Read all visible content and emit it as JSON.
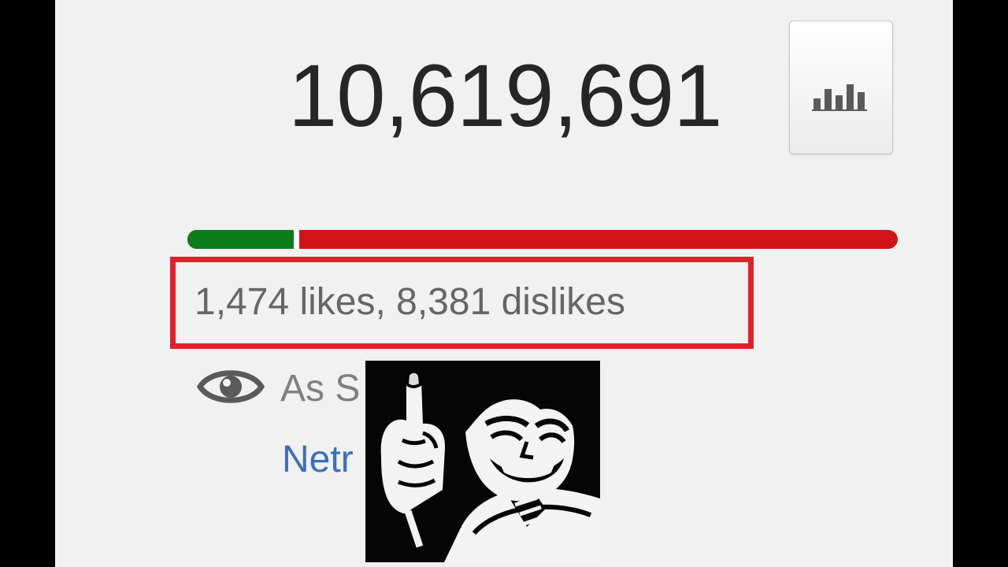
{
  "video": {
    "view_count": "10,619,691",
    "likes_dislikes": "1,474 likes, 8,381 dislikes",
    "likes_ratio": 0.15
  },
  "channel": {
    "visible_text": "As S"
  },
  "related": {
    "link_text": "Netr                    El po..."
  },
  "icons": {
    "stats": "bar-chart-icon",
    "privacy": "eye-icon",
    "meme": "reaction-meme-image"
  },
  "colors": {
    "likes": "#0b7d1b",
    "dislikes": "#d11418",
    "highlight": "#e3202a",
    "link": "#3d6fb8",
    "count": "#262626"
  }
}
